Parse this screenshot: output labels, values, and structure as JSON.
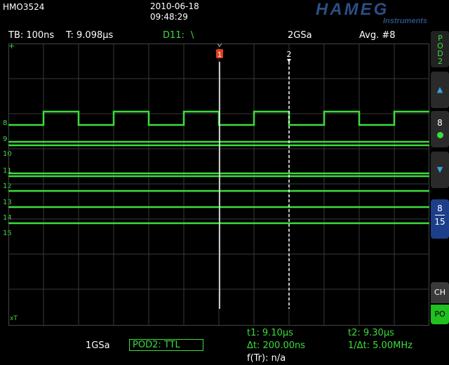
{
  "header": {
    "model": "HMO3524",
    "date": "2010-06-18",
    "time": "09:48:29",
    "brand": "HAMEG",
    "brand_sub": "Instruments"
  },
  "status": {
    "timebase": "TB: 100ns",
    "trigger_time": "T: 9.098µs",
    "trigger_source": "D11:",
    "trigger_edge": "\\",
    "sample_rate": "2GSa",
    "acquisition": "Avg. #8"
  },
  "markers": {
    "cursor1": "1",
    "cursor2": "2"
  },
  "channels": [
    "8",
    "9",
    "10",
    "11",
    "12",
    "13",
    "14",
    "15"
  ],
  "right_panel": {
    "pod_label": "POD2",
    "up_arrow": "▲",
    "channel_selected": "8",
    "down_arrow": "▼",
    "range_top": "8",
    "range_bottom": "15",
    "ch_label": "CH",
    "po_label": "PO"
  },
  "bottom": {
    "sample_rate": "1GSa",
    "pod_threshold": "POD2: TTL",
    "t1": "t1: 9.10µs",
    "t2": "t2: 9.30µs",
    "delta_t": "Δt: 200.00ns",
    "inv_delta_t": "1/Δt: 5.00MHz",
    "freq": "f(Tr): n/a"
  },
  "colors": {
    "trace": "#3ddc3d",
    "grid": "#3a3a3a",
    "brand": "#2b4e84",
    "cursor_marker": "#e04020",
    "panel_active": "#1d3f8a"
  }
}
